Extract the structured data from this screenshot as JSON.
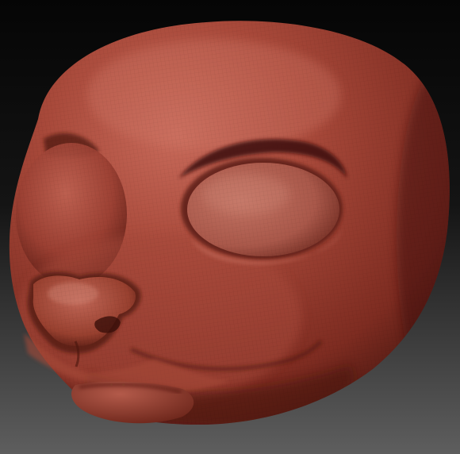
{
  "viewport": {
    "background_top": "#050505",
    "background_bottom": "#5e5e5e",
    "model_color": "#9a3f32",
    "model_highlight": "#c86a5a",
    "model_shadow": "#3e120c",
    "wireframe_visible": true
  }
}
